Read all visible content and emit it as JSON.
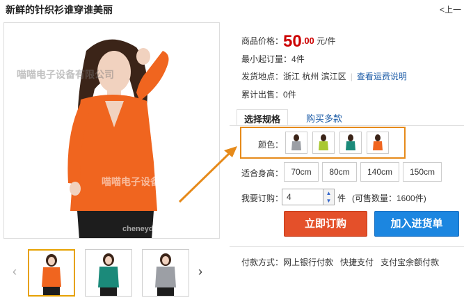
{
  "header": {
    "title": "新鲜的针织衫谁穿谁美丽",
    "prev_link": "<上一"
  },
  "watermarks": [
    "喵喵电子设备有限公司",
    "喵喵电子设备有限公司",
    "cheneyd"
  ],
  "price": {
    "label": "商品价格：",
    "integer": "50",
    "decimal": ".00",
    "unit": "元/件"
  },
  "min_order": {
    "label": "最小起订量：",
    "value": "4件"
  },
  "ship_from": {
    "label": "发货地点：",
    "value": "浙江 杭州 滨江区",
    "sep": "|",
    "link": "查看运费说明"
  },
  "sold": {
    "label": "累计出售：",
    "value": "0件"
  },
  "tabs": [
    {
      "label": "选择规格"
    },
    {
      "label": "购买多款"
    }
  ],
  "color": {
    "label": "颜色：",
    "swatches": [
      "gray",
      "yellow-green",
      "teal",
      "orange"
    ]
  },
  "size": {
    "label": "适合身高：",
    "options": [
      "70cm",
      "80cm",
      "140cm",
      "150cm"
    ]
  },
  "quantity": {
    "label": "我要订购：",
    "value": "4",
    "unit": "件",
    "available": "(可售数量：1600件)"
  },
  "buttons": {
    "buy_now": "立即订购",
    "add_cart": "加入进货单"
  },
  "payment": {
    "label": "付款方式：",
    "methods": [
      "网上银行付款",
      "快捷支付",
      "支付宝余额付款"
    ]
  },
  "icons": {
    "left_arrow": "chevron-left-icon",
    "right_arrow": "chevron-right-icon",
    "up": "caret-up-icon",
    "down": "caret-down-icon"
  },
  "colors": {
    "price_red": "#cc0000",
    "link_blue": "#1f5ea8",
    "highlight_orange": "#e68a1a",
    "buy_orange": "#e4502a",
    "cart_blue": "#1c86e0"
  }
}
